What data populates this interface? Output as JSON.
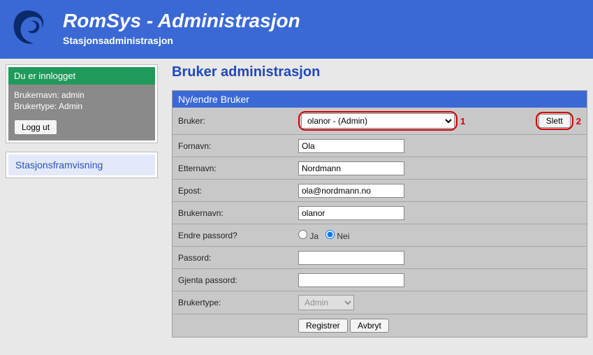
{
  "header": {
    "title": "RomSys - Administrasjon",
    "subtitle": "Stasjonsadministrasjon"
  },
  "sidebar": {
    "login_title": "Du er innlogget",
    "username_label": "Brukernavn:",
    "username_value": "admin",
    "usertype_label": "Brukertype:",
    "usertype_value": "Admin",
    "logout": "Logg ut",
    "nav_item": "Stasjonsframvisning"
  },
  "main": {
    "page_title": "Bruker administrasjon",
    "form_title": "Ny/endre Bruker",
    "labels": {
      "bruker": "Bruker:",
      "fornavn": "Fornavn:",
      "etternavn": "Etternavn:",
      "epost": "Epost:",
      "brukernavn": "Brukernavn:",
      "endre_passord": "Endre passord?",
      "passord": "Passord:",
      "gjenta_passord": "Gjenta passord:",
      "brukertype": "Brukertype:"
    },
    "values": {
      "bruker_selected": "olanor - (Admin)",
      "fornavn": "Ola",
      "etternavn": "Nordmann",
      "epost": "ola@nordmann.no",
      "brukernavn": "olanor",
      "ja": "Ja",
      "nei": "Nei",
      "brukertype": "Admin"
    },
    "buttons": {
      "slett": "Slett",
      "registrer": "Registrer",
      "avbryt": "Avbryt"
    },
    "annotations": {
      "one": "1",
      "two": "2"
    }
  }
}
